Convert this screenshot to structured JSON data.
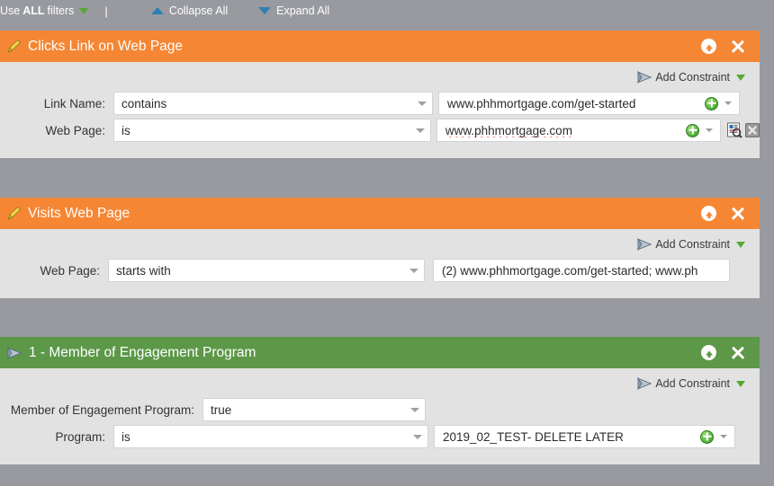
{
  "toolbar": {
    "use_filters_prefix": "Use",
    "use_filters_strong": "ALL",
    "use_filters_suffix": "filters",
    "filters_caret_icon": "green-down-triangle-icon",
    "separator": "|",
    "collapse_all": "Collapse All",
    "collapse_icon": "blue-up-triangle-icon",
    "expand_all": "Expand All",
    "expand_icon": "blue-down-triangle-icon"
  },
  "colors": {
    "orange_header": "#f58634",
    "green_header": "#5c9848",
    "panel_body": "#e2e2e2",
    "page_background": "#989aa0",
    "green_accent": "#56a832",
    "blue_accent": "#2f7fb5"
  },
  "panels": [
    {
      "title": "Clicks Link on Web Page",
      "header_color": "orange",
      "icon": "pencil-edit-icon",
      "move_up_icon": "up-arrow-circle-icon",
      "close_icon": "close-x-icon",
      "add_constraint": {
        "label": "Add Constraint",
        "icon": "arrow-pointer-icon",
        "caret_icon": "green-down-triangle-icon"
      },
      "rows": [
        {
          "label": "Link Name:",
          "operator": "contains",
          "value": "www.phhmortgage.com/get-started",
          "has_plus": true,
          "has_value_caret": true,
          "spellcheck_underline": false,
          "extra_icons": []
        },
        {
          "label": "Web Page:",
          "operator": "is",
          "value": "www.phhmortgage.com",
          "has_plus": true,
          "has_value_caret": true,
          "spellcheck_underline": true,
          "extra_icons": [
            "document-search-icon",
            "close-square-icon"
          ]
        }
      ]
    },
    {
      "title": "Visits Web Page",
      "header_color": "orange",
      "icon": "pencil-edit-icon",
      "move_up_icon": "up-arrow-circle-icon",
      "close_icon": "close-x-icon",
      "add_constraint": {
        "label": "Add Constraint",
        "icon": "arrow-pointer-icon",
        "caret_icon": "green-down-triangle-icon"
      },
      "rows": [
        {
          "label": "Web Page:",
          "operator": "starts with",
          "value": "(2) www.phhmortgage.com/get-started; www.ph",
          "has_plus": false,
          "has_value_caret": false,
          "spellcheck_underline": false,
          "extra_icons": []
        }
      ]
    },
    {
      "title": "1 - Member of Engagement Program",
      "header_color": "green",
      "icon": "arrow-pointer-icon",
      "move_up_icon": "up-arrow-circle-icon",
      "close_icon": "close-x-icon",
      "add_constraint": {
        "label": "Add Constraint",
        "icon": "arrow-pointer-icon",
        "caret_icon": "green-down-triangle-icon"
      },
      "rows": [
        {
          "label": "Member of Engagement Program:",
          "operator": "true",
          "value": "",
          "has_plus": false,
          "has_value_caret": false,
          "spellcheck_underline": false,
          "extra_icons": []
        },
        {
          "label": "Program:",
          "operator": "is",
          "value": "2019_02_TEST- DELETE LATER",
          "has_plus": true,
          "has_value_caret": true,
          "spellcheck_underline": false,
          "extra_icons": []
        }
      ]
    }
  ]
}
